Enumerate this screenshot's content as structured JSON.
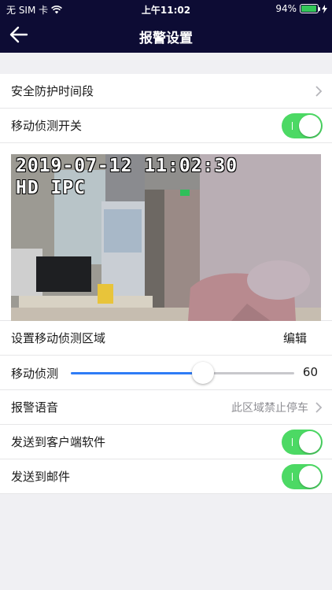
{
  "statusbar": {
    "carrier": "无 SIM 卡",
    "time": "上午11:02",
    "battery": "94%",
    "battery_level": 0.94
  },
  "nav": {
    "title": "报警设置",
    "back_icon": "arrow-left-icon"
  },
  "rows": {
    "schedule": {
      "label": "安全防护时间段"
    },
    "motion_switch": {
      "label": "移动侦测开关",
      "on": true
    },
    "region": {
      "label": "设置移动侦测区域",
      "action": "编辑"
    },
    "sensitivity": {
      "label": "移动侦测",
      "value": "60",
      "fraction": 0.6
    },
    "voice": {
      "label": "报警语音",
      "value": "此区域禁止停车"
    },
    "send_client": {
      "label": "发送到客户端软件",
      "on": true
    },
    "send_mail": {
      "label": "发送到邮件",
      "on": true
    }
  },
  "camera": {
    "timestamp": "2019-07-12 11:02:30",
    "channel": "HD IPC"
  },
  "colors": {
    "header_bg": "#0d0c34",
    "toggle_on": "#4cd964",
    "slider_fill": "#2f7cf6",
    "page_bg": "#f0f0f3"
  }
}
